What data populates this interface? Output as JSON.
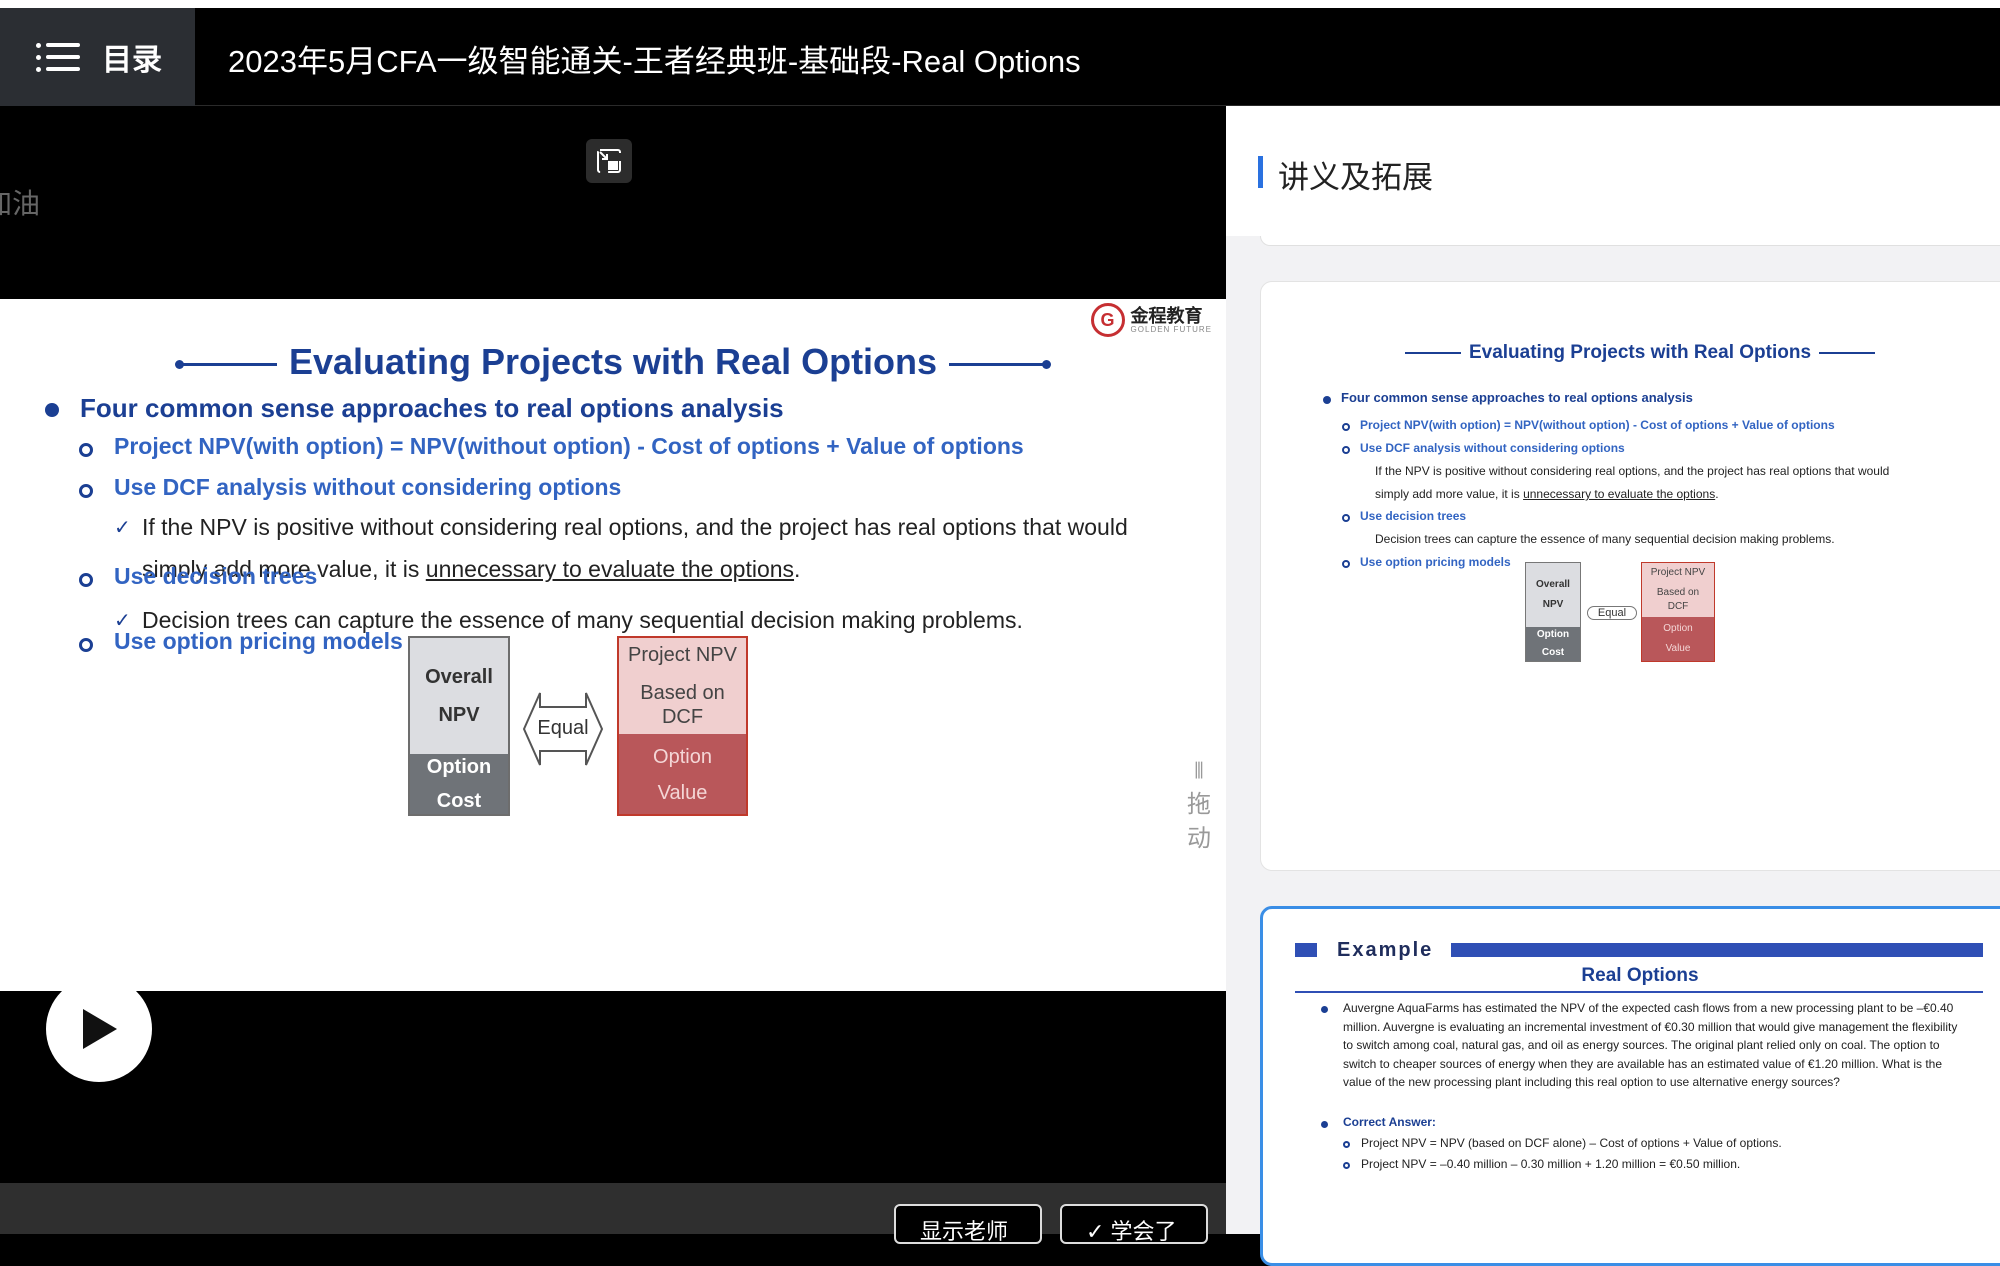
{
  "header": {
    "menu_label": "目录",
    "course_title": "2023年5月CFA一级智能通关-王者经典班-基础段-Real Options"
  },
  "video": {
    "cheer_text": "加油!",
    "drag_label": [
      "拖",
      "动"
    ],
    "buttons": [
      "显示老师",
      "✓ 学会了"
    ]
  },
  "slide": {
    "logo_cn": "金程教育",
    "logo_en": "GOLDEN FUTURE",
    "logo_mark": "G",
    "title": "Evaluating Projects with Real Options",
    "bullet": "Four common sense approaches to real options analysis",
    "sub1": "Project NPV(with option) = NPV(without option) - Cost of options + Value of options",
    "sub2": "Use DCF analysis without considering options",
    "sub2_text_a": "If the NPV is positive without considering real options, and the project has real options that would",
    "sub2_text_b": "simply add more value, it is ",
    "sub2_text_u": "unnecessary to evaluate the options",
    "sub2_text_c": ".",
    "sub3": "Use decision trees",
    "sub3_text": "Decision trees can capture the essence of many sequential decision making problems.",
    "sub4": "Use option pricing models",
    "diagram": {
      "overall": "Overall",
      "npv": "NPV",
      "option": "Option",
      "cost": "Cost",
      "equal": "Equal",
      "project_npv": "Project NPV",
      "based_on": "Based on",
      "dcf": "DCF",
      "option_r": "Option",
      "value": "Value"
    }
  },
  "sidebar": {
    "title": "讲义及拓展",
    "example": {
      "heading": "Example",
      "subtitle": "Real Options",
      "question": "Auvergne AquaFarms has estimated the NPV of the expected cash flows from a new processing plant to be –€0.40 million. Auvergne is evaluating an incremental investment of €0.30 million that would give management the flexibility to switch among coal, natural gas, and oil as energy sources. The original plant relied only on coal. The option to switch to cheaper sources of energy when they are available has an estimated value of €1.20 million. What is the value of the new processing plant including this real option to use alternative energy sources?",
      "answer_label": "Correct Answer:",
      "answer_1": "Project NPV = NPV (based on DCF alone) – Cost of options + Value of options.",
      "answer_2": "Project NPV = –0.40 million – 0.30 million + 1.20 million = €0.50 million."
    }
  },
  "colors": {
    "slide_blue": "#1b3f93",
    "sub_blue": "#3264c2",
    "accent_blue": "#3a8ee6",
    "option_red": "#b9575a"
  }
}
